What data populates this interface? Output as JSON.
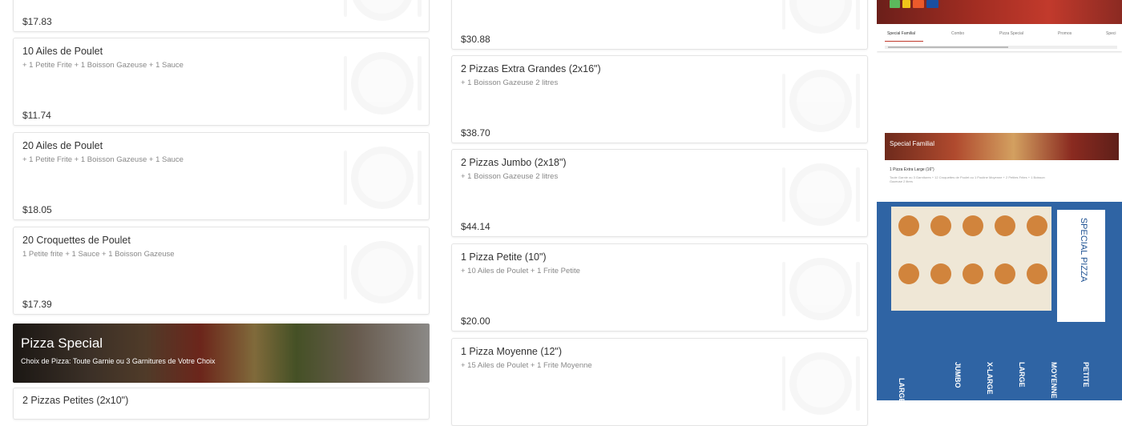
{
  "left_column": {
    "items": [
      {
        "title": "",
        "desc": "",
        "price": "$17.83"
      },
      {
        "title": "10 Ailes de Poulet",
        "desc": "+ 1 Petite Frite + 1 Boisson Gazeuse + 1 Sauce",
        "price": "$11.74"
      },
      {
        "title": "20 Ailes de Poulet",
        "desc": "+ 1 Petite Frite + 1 Boisson Gazeuse + 1 Sauce",
        "price": "$18.05"
      },
      {
        "title": "20 Croquettes de Poulet",
        "desc": "1 Petite frite + 1 Sauce + 1 Boisson Gazeuse",
        "price": "$17.39"
      }
    ],
    "banner": {
      "title": "Pizza Special",
      "subtitle": "Choix de Pizza: Toute Garnie ou 3 Garnitures de Votre Choix"
    },
    "partial_item": {
      "title": "2 Pizzas Petites (2x10\")"
    }
  },
  "middle_column": {
    "items": [
      {
        "title": "",
        "desc": "",
        "price": "$30.88"
      },
      {
        "title": "2 Pizzas Extra Grandes (2x16\")",
        "desc": "+ 1 Boisson Gazeuse 2 litres",
        "price": "$38.70"
      },
      {
        "title": "2 Pizzas Jumbo (2x18\")",
        "desc": "+ 1 Boisson Gazeuse 2 litres",
        "price": "$44.14"
      },
      {
        "title": "1 Pizza Petite (10\")",
        "desc": "+ 10 Ailes de Poulet + 1 Frite Petite",
        "price": "$20.00"
      },
      {
        "title": "1 Pizza Moyenne (12\")",
        "desc": "+ 15 Ailes de Poulet + 1 Frite Moyenne",
        "price": ""
      }
    ]
  },
  "right_panel": {
    "tabs": [
      "Special Familial",
      "Combo",
      "Pizza Special",
      "Promos",
      "Speci"
    ],
    "active_tab": "Special Familial",
    "mini_banner_title": "Special Familial",
    "mini_item": {
      "title": "1 Pizza Extra Large (16\")",
      "desc": "Toute Garnie ou 3 Garnitures + 12 Croquettes de Poulet ou 1 Poutine Moyenne + 2 Petites Frites + 1 Boisson Gazeuse 2 litres"
    },
    "flyer_text": [
      "SPECIAL PIZZA",
      "LARGE",
      "JUMBO",
      "X-LARGE",
      "LARGE",
      "MOYENNE",
      "PETITE"
    ]
  },
  "icons": [
    "plate-icon",
    "fork-icon",
    "knife-icon"
  ],
  "colors": {
    "accent": "#c0392b",
    "banner_overlay": "#000000"
  }
}
